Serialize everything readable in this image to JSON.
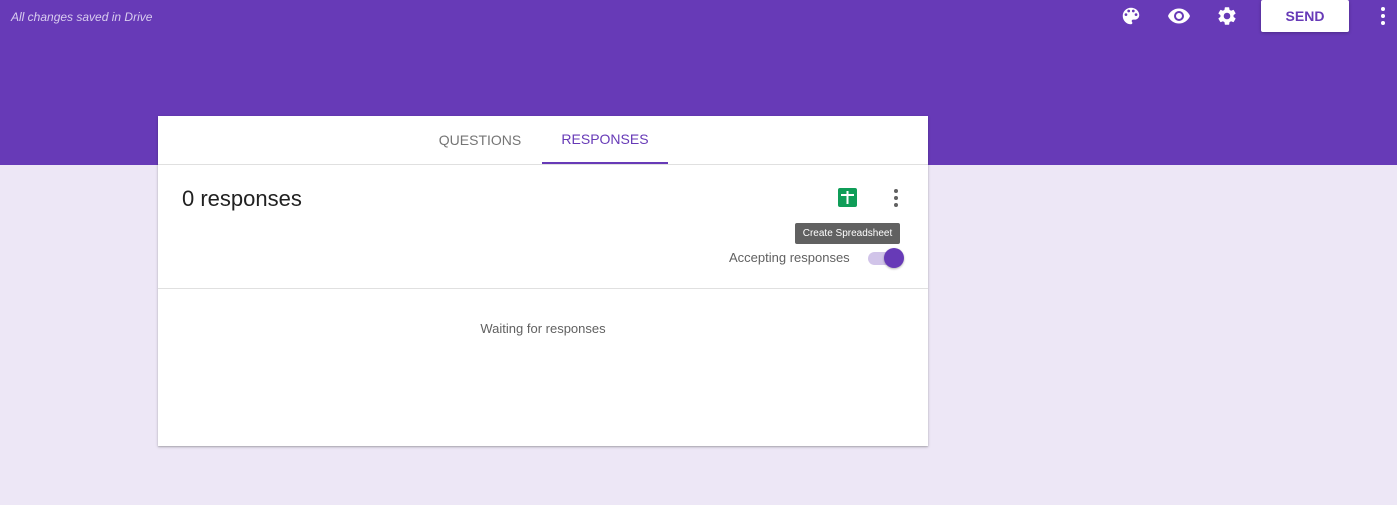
{
  "header": {
    "saved_status": "All changes saved in Drive",
    "send_label": "SEND",
    "icons": [
      "palette-icon",
      "eye-icon",
      "gear-icon",
      "more-vert-icon"
    ],
    "accent_color": "#673ab7",
    "page_background": "#ede7f6"
  },
  "tabs": [
    {
      "label": "QUESTIONS",
      "active": false
    },
    {
      "label": "RESPONSES",
      "active": true
    }
  ],
  "responses": {
    "count_title": "0 responses",
    "spreadsheet_tooltip": "Create Spreadsheet",
    "accepting_label": "Accepting responses",
    "accepting_enabled": true,
    "empty_message": "Waiting for responses"
  }
}
